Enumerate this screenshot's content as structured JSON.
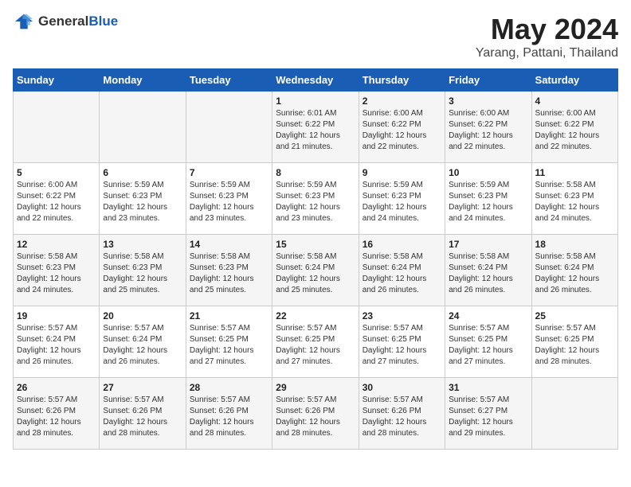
{
  "header": {
    "logo_general": "General",
    "logo_blue": "Blue",
    "month_year": "May 2024",
    "location": "Yarang, Pattani, Thailand"
  },
  "weekdays": [
    "Sunday",
    "Monday",
    "Tuesday",
    "Wednesday",
    "Thursday",
    "Friday",
    "Saturday"
  ],
  "weeks": [
    [
      {
        "day": "",
        "sunrise": "",
        "sunset": "",
        "daylight": ""
      },
      {
        "day": "",
        "sunrise": "",
        "sunset": "",
        "daylight": ""
      },
      {
        "day": "",
        "sunrise": "",
        "sunset": "",
        "daylight": ""
      },
      {
        "day": "1",
        "sunrise": "Sunrise: 6:01 AM",
        "sunset": "Sunset: 6:22 PM",
        "daylight": "Daylight: 12 hours and 21 minutes."
      },
      {
        "day": "2",
        "sunrise": "Sunrise: 6:00 AM",
        "sunset": "Sunset: 6:22 PM",
        "daylight": "Daylight: 12 hours and 22 minutes."
      },
      {
        "day": "3",
        "sunrise": "Sunrise: 6:00 AM",
        "sunset": "Sunset: 6:22 PM",
        "daylight": "Daylight: 12 hours and 22 minutes."
      },
      {
        "day": "4",
        "sunrise": "Sunrise: 6:00 AM",
        "sunset": "Sunset: 6:22 PM",
        "daylight": "Daylight: 12 hours and 22 minutes."
      }
    ],
    [
      {
        "day": "5",
        "sunrise": "Sunrise: 6:00 AM",
        "sunset": "Sunset: 6:22 PM",
        "daylight": "Daylight: 12 hours and 22 minutes."
      },
      {
        "day": "6",
        "sunrise": "Sunrise: 5:59 AM",
        "sunset": "Sunset: 6:23 PM",
        "daylight": "Daylight: 12 hours and 23 minutes."
      },
      {
        "day": "7",
        "sunrise": "Sunrise: 5:59 AM",
        "sunset": "Sunset: 6:23 PM",
        "daylight": "Daylight: 12 hours and 23 minutes."
      },
      {
        "day": "8",
        "sunrise": "Sunrise: 5:59 AM",
        "sunset": "Sunset: 6:23 PM",
        "daylight": "Daylight: 12 hours and 23 minutes."
      },
      {
        "day": "9",
        "sunrise": "Sunrise: 5:59 AM",
        "sunset": "Sunset: 6:23 PM",
        "daylight": "Daylight: 12 hours and 24 minutes."
      },
      {
        "day": "10",
        "sunrise": "Sunrise: 5:59 AM",
        "sunset": "Sunset: 6:23 PM",
        "daylight": "Daylight: 12 hours and 24 minutes."
      },
      {
        "day": "11",
        "sunrise": "Sunrise: 5:58 AM",
        "sunset": "Sunset: 6:23 PM",
        "daylight": "Daylight: 12 hours and 24 minutes."
      }
    ],
    [
      {
        "day": "12",
        "sunrise": "Sunrise: 5:58 AM",
        "sunset": "Sunset: 6:23 PM",
        "daylight": "Daylight: 12 hours and 24 minutes."
      },
      {
        "day": "13",
        "sunrise": "Sunrise: 5:58 AM",
        "sunset": "Sunset: 6:23 PM",
        "daylight": "Daylight: 12 hours and 25 minutes."
      },
      {
        "day": "14",
        "sunrise": "Sunrise: 5:58 AM",
        "sunset": "Sunset: 6:23 PM",
        "daylight": "Daylight: 12 hours and 25 minutes."
      },
      {
        "day": "15",
        "sunrise": "Sunrise: 5:58 AM",
        "sunset": "Sunset: 6:24 PM",
        "daylight": "Daylight: 12 hours and 25 minutes."
      },
      {
        "day": "16",
        "sunrise": "Sunrise: 5:58 AM",
        "sunset": "Sunset: 6:24 PM",
        "daylight": "Daylight: 12 hours and 26 minutes."
      },
      {
        "day": "17",
        "sunrise": "Sunrise: 5:58 AM",
        "sunset": "Sunset: 6:24 PM",
        "daylight": "Daylight: 12 hours and 26 minutes."
      },
      {
        "day": "18",
        "sunrise": "Sunrise: 5:58 AM",
        "sunset": "Sunset: 6:24 PM",
        "daylight": "Daylight: 12 hours and 26 minutes."
      }
    ],
    [
      {
        "day": "19",
        "sunrise": "Sunrise: 5:57 AM",
        "sunset": "Sunset: 6:24 PM",
        "daylight": "Daylight: 12 hours and 26 minutes."
      },
      {
        "day": "20",
        "sunrise": "Sunrise: 5:57 AM",
        "sunset": "Sunset: 6:24 PM",
        "daylight": "Daylight: 12 hours and 26 minutes."
      },
      {
        "day": "21",
        "sunrise": "Sunrise: 5:57 AM",
        "sunset": "Sunset: 6:25 PM",
        "daylight": "Daylight: 12 hours and 27 minutes."
      },
      {
        "day": "22",
        "sunrise": "Sunrise: 5:57 AM",
        "sunset": "Sunset: 6:25 PM",
        "daylight": "Daylight: 12 hours and 27 minutes."
      },
      {
        "day": "23",
        "sunrise": "Sunrise: 5:57 AM",
        "sunset": "Sunset: 6:25 PM",
        "daylight": "Daylight: 12 hours and 27 minutes."
      },
      {
        "day": "24",
        "sunrise": "Sunrise: 5:57 AM",
        "sunset": "Sunset: 6:25 PM",
        "daylight": "Daylight: 12 hours and 27 minutes."
      },
      {
        "day": "25",
        "sunrise": "Sunrise: 5:57 AM",
        "sunset": "Sunset: 6:25 PM",
        "daylight": "Daylight: 12 hours and 28 minutes."
      }
    ],
    [
      {
        "day": "26",
        "sunrise": "Sunrise: 5:57 AM",
        "sunset": "Sunset: 6:26 PM",
        "daylight": "Daylight: 12 hours and 28 minutes."
      },
      {
        "day": "27",
        "sunrise": "Sunrise: 5:57 AM",
        "sunset": "Sunset: 6:26 PM",
        "daylight": "Daylight: 12 hours and 28 minutes."
      },
      {
        "day": "28",
        "sunrise": "Sunrise: 5:57 AM",
        "sunset": "Sunset: 6:26 PM",
        "daylight": "Daylight: 12 hours and 28 minutes."
      },
      {
        "day": "29",
        "sunrise": "Sunrise: 5:57 AM",
        "sunset": "Sunset: 6:26 PM",
        "daylight": "Daylight: 12 hours and 28 minutes."
      },
      {
        "day": "30",
        "sunrise": "Sunrise: 5:57 AM",
        "sunset": "Sunset: 6:26 PM",
        "daylight": "Daylight: 12 hours and 28 minutes."
      },
      {
        "day": "31",
        "sunrise": "Sunrise: 5:57 AM",
        "sunset": "Sunset: 6:27 PM",
        "daylight": "Daylight: 12 hours and 29 minutes."
      },
      {
        "day": "",
        "sunrise": "",
        "sunset": "",
        "daylight": ""
      }
    ]
  ]
}
